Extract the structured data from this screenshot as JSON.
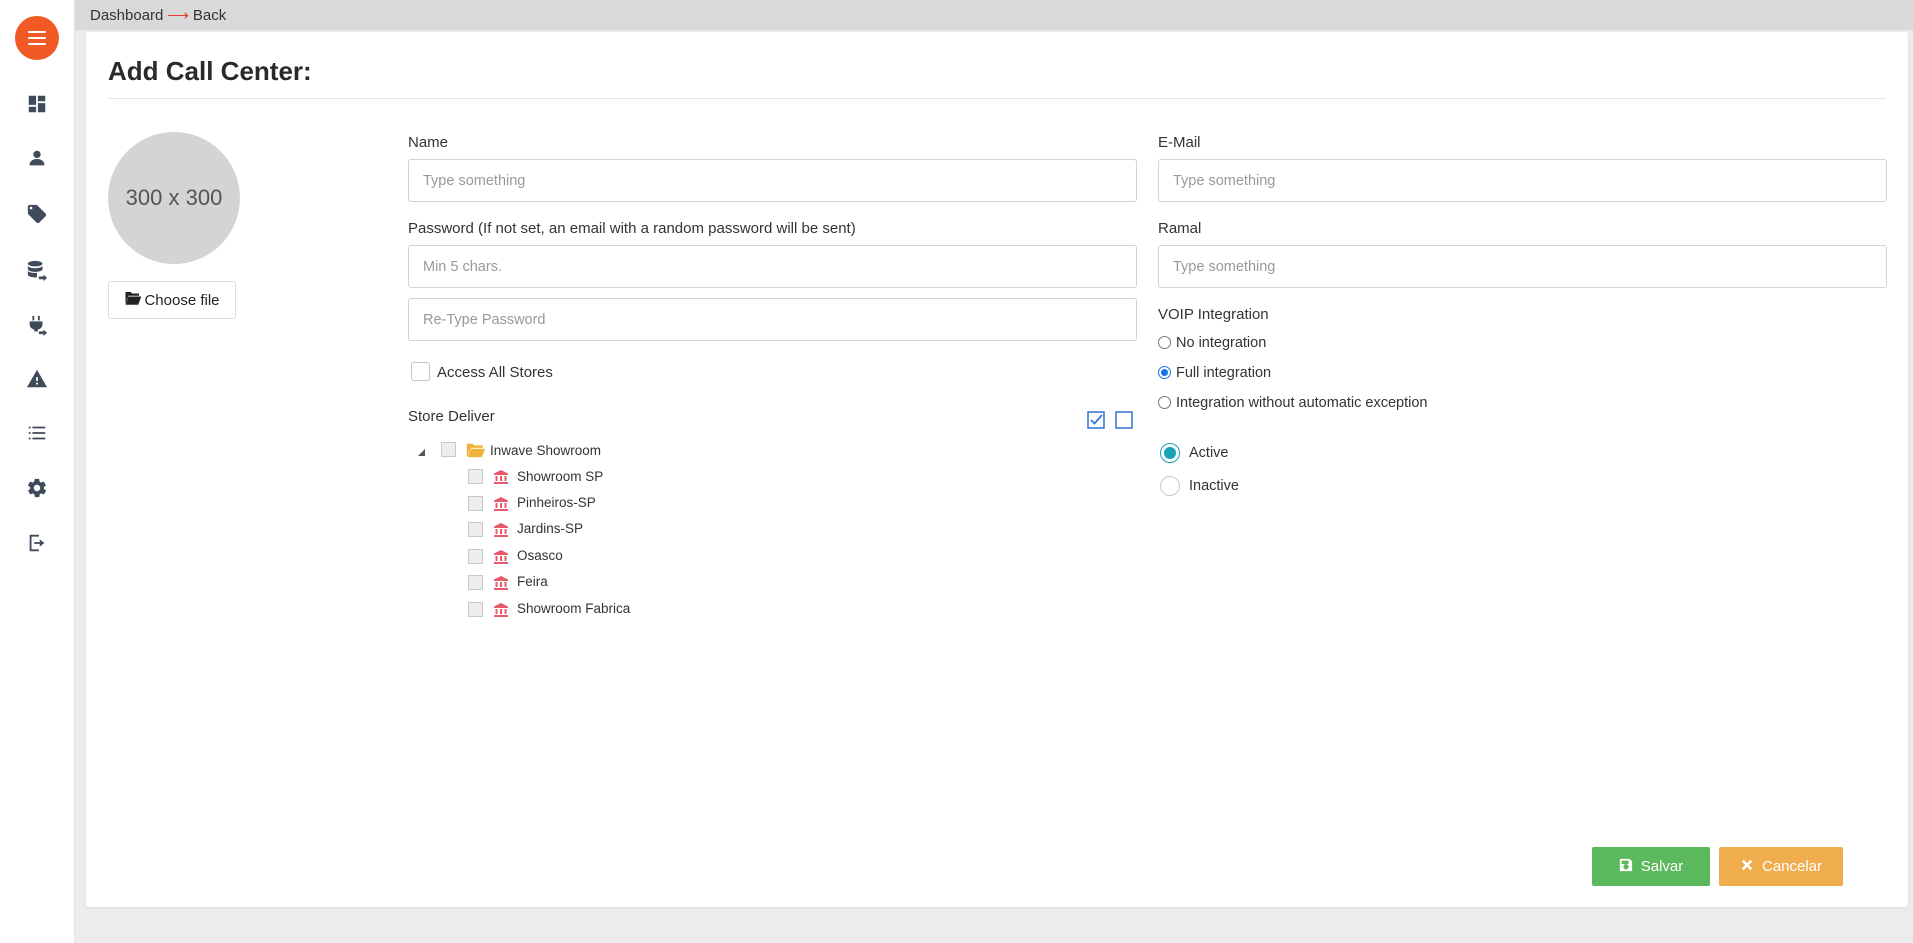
{
  "breadcrumb": {
    "dashboard": "Dashboard",
    "arrow": "⟶",
    "back": "Back"
  },
  "page": {
    "title": "Add Call Center:"
  },
  "avatar": {
    "placeholder_text": "300 x 300",
    "choose_file_label": "Choose file"
  },
  "form": {
    "name": {
      "label": "Name",
      "placeholder": "Type something"
    },
    "email": {
      "label": "E-Mail",
      "placeholder": "Type something"
    },
    "password": {
      "label": "Password (If not set, an email with a random password will be sent)",
      "placeholder": "Min 5 chars."
    },
    "retype_password": {
      "placeholder": "Re-Type Password"
    },
    "ramal": {
      "label": "Ramal",
      "placeholder": "Type something"
    },
    "access_all_stores": {
      "label": "Access All Stores",
      "checked": false
    },
    "voip": {
      "label": "VOIP Integration",
      "options": [
        "No integration",
        "Full integration",
        "Integration without automatic exception"
      ],
      "selected": "Full integration"
    },
    "status": {
      "options": [
        "Active",
        "Inactive"
      ],
      "selected": "Active"
    }
  },
  "store_deliver": {
    "label": "Store Deliver",
    "root": {
      "label": "Inwave Showroom",
      "expanded": true
    },
    "stores": [
      "Showroom SP",
      "Pinheiros-SP",
      "Jardins-SP",
      "Osasco",
      "Feira",
      "Showroom Fabrica"
    ]
  },
  "actions": {
    "save_label": "Salvar",
    "cancel_label": "Cancelar"
  },
  "colors": {
    "accent": "#f15a24",
    "save": "#5cb85c",
    "cancel": "#f0ad4e",
    "active_radio": "#17a2b8",
    "store_icon": "#e85a6b",
    "folder_icon": "#f0b43c"
  },
  "sidebar_icons": [
    "dashboard-icon",
    "users-icon",
    "tag-icon",
    "database-export-icon",
    "plug-export-icon",
    "warning-icon",
    "list-icon",
    "gear-icon",
    "logout-icon"
  ]
}
